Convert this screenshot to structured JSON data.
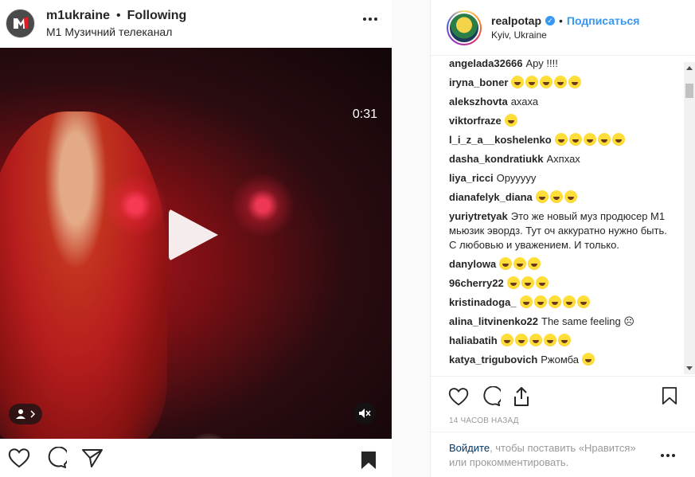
{
  "post": {
    "username": "m1ukraine",
    "separator": "•",
    "follow_state": "Following",
    "subtitle": "М1 Музичний телеканал",
    "video_time": "0:31"
  },
  "right": {
    "username": "realpotap",
    "separator": "•",
    "subscribe_label": "Подписаться",
    "location": "Kyiv, Ukraine",
    "time_ago": "14 ЧАСОВ НАЗАД",
    "login_link": "Войдите",
    "login_text": ", чтобы поставить «Нравится» или прокомментировать."
  },
  "comments": [
    {
      "user": "angelada32666",
      "text": "Ару !!!!",
      "emoji": 0
    },
    {
      "user": "iryna_boner",
      "text": "",
      "emoji": 5
    },
    {
      "user": "alekszhovta",
      "text": "ахаха",
      "emoji": 0
    },
    {
      "user": "viktorfraze",
      "text": "",
      "emoji": 1
    },
    {
      "user": "l_i_z_a__koshelenko",
      "text": "",
      "emoji": 5
    },
    {
      "user": "dasha_kondratiukk",
      "text": "Ахпхах",
      "emoji": 0
    },
    {
      "user": "liya_ricci",
      "text": "Орууууу",
      "emoji": 0
    },
    {
      "user": "dianafelyk_diana",
      "text": "",
      "emoji": 3
    },
    {
      "user": "yuriytretyak",
      "text": "Это же новый муз продюсер М1 мьюзик эвордз. Тут оч аккуратно нужно быть. С любовью и уважением. И только.",
      "emoji": 0
    },
    {
      "user": "danylowa",
      "text": "",
      "emoji": 3
    },
    {
      "user": "96cherry22",
      "text": "",
      "emoji": 3
    },
    {
      "user": "kristinadoga_",
      "text": "",
      "emoji": 5
    },
    {
      "user": "alina_litvinenko22",
      "text": "The same feeling ☹",
      "emoji": 0
    },
    {
      "user": "haliabatih",
      "text": "",
      "emoji": 5
    },
    {
      "user": "katya_trigubovich",
      "text": "Ржомба",
      "emoji": 1
    }
  ],
  "icons": {
    "heart": "heart-icon",
    "comment": "comment-icon",
    "share": "share-icon",
    "bookmark": "bookmark-icon",
    "more": "more-icon",
    "play": "play-icon",
    "mute": "mute-icon",
    "user_tag": "user-tag-icon"
  },
  "colors": {
    "link": "#3897f0",
    "text": "#262626",
    "muted": "#999999"
  }
}
